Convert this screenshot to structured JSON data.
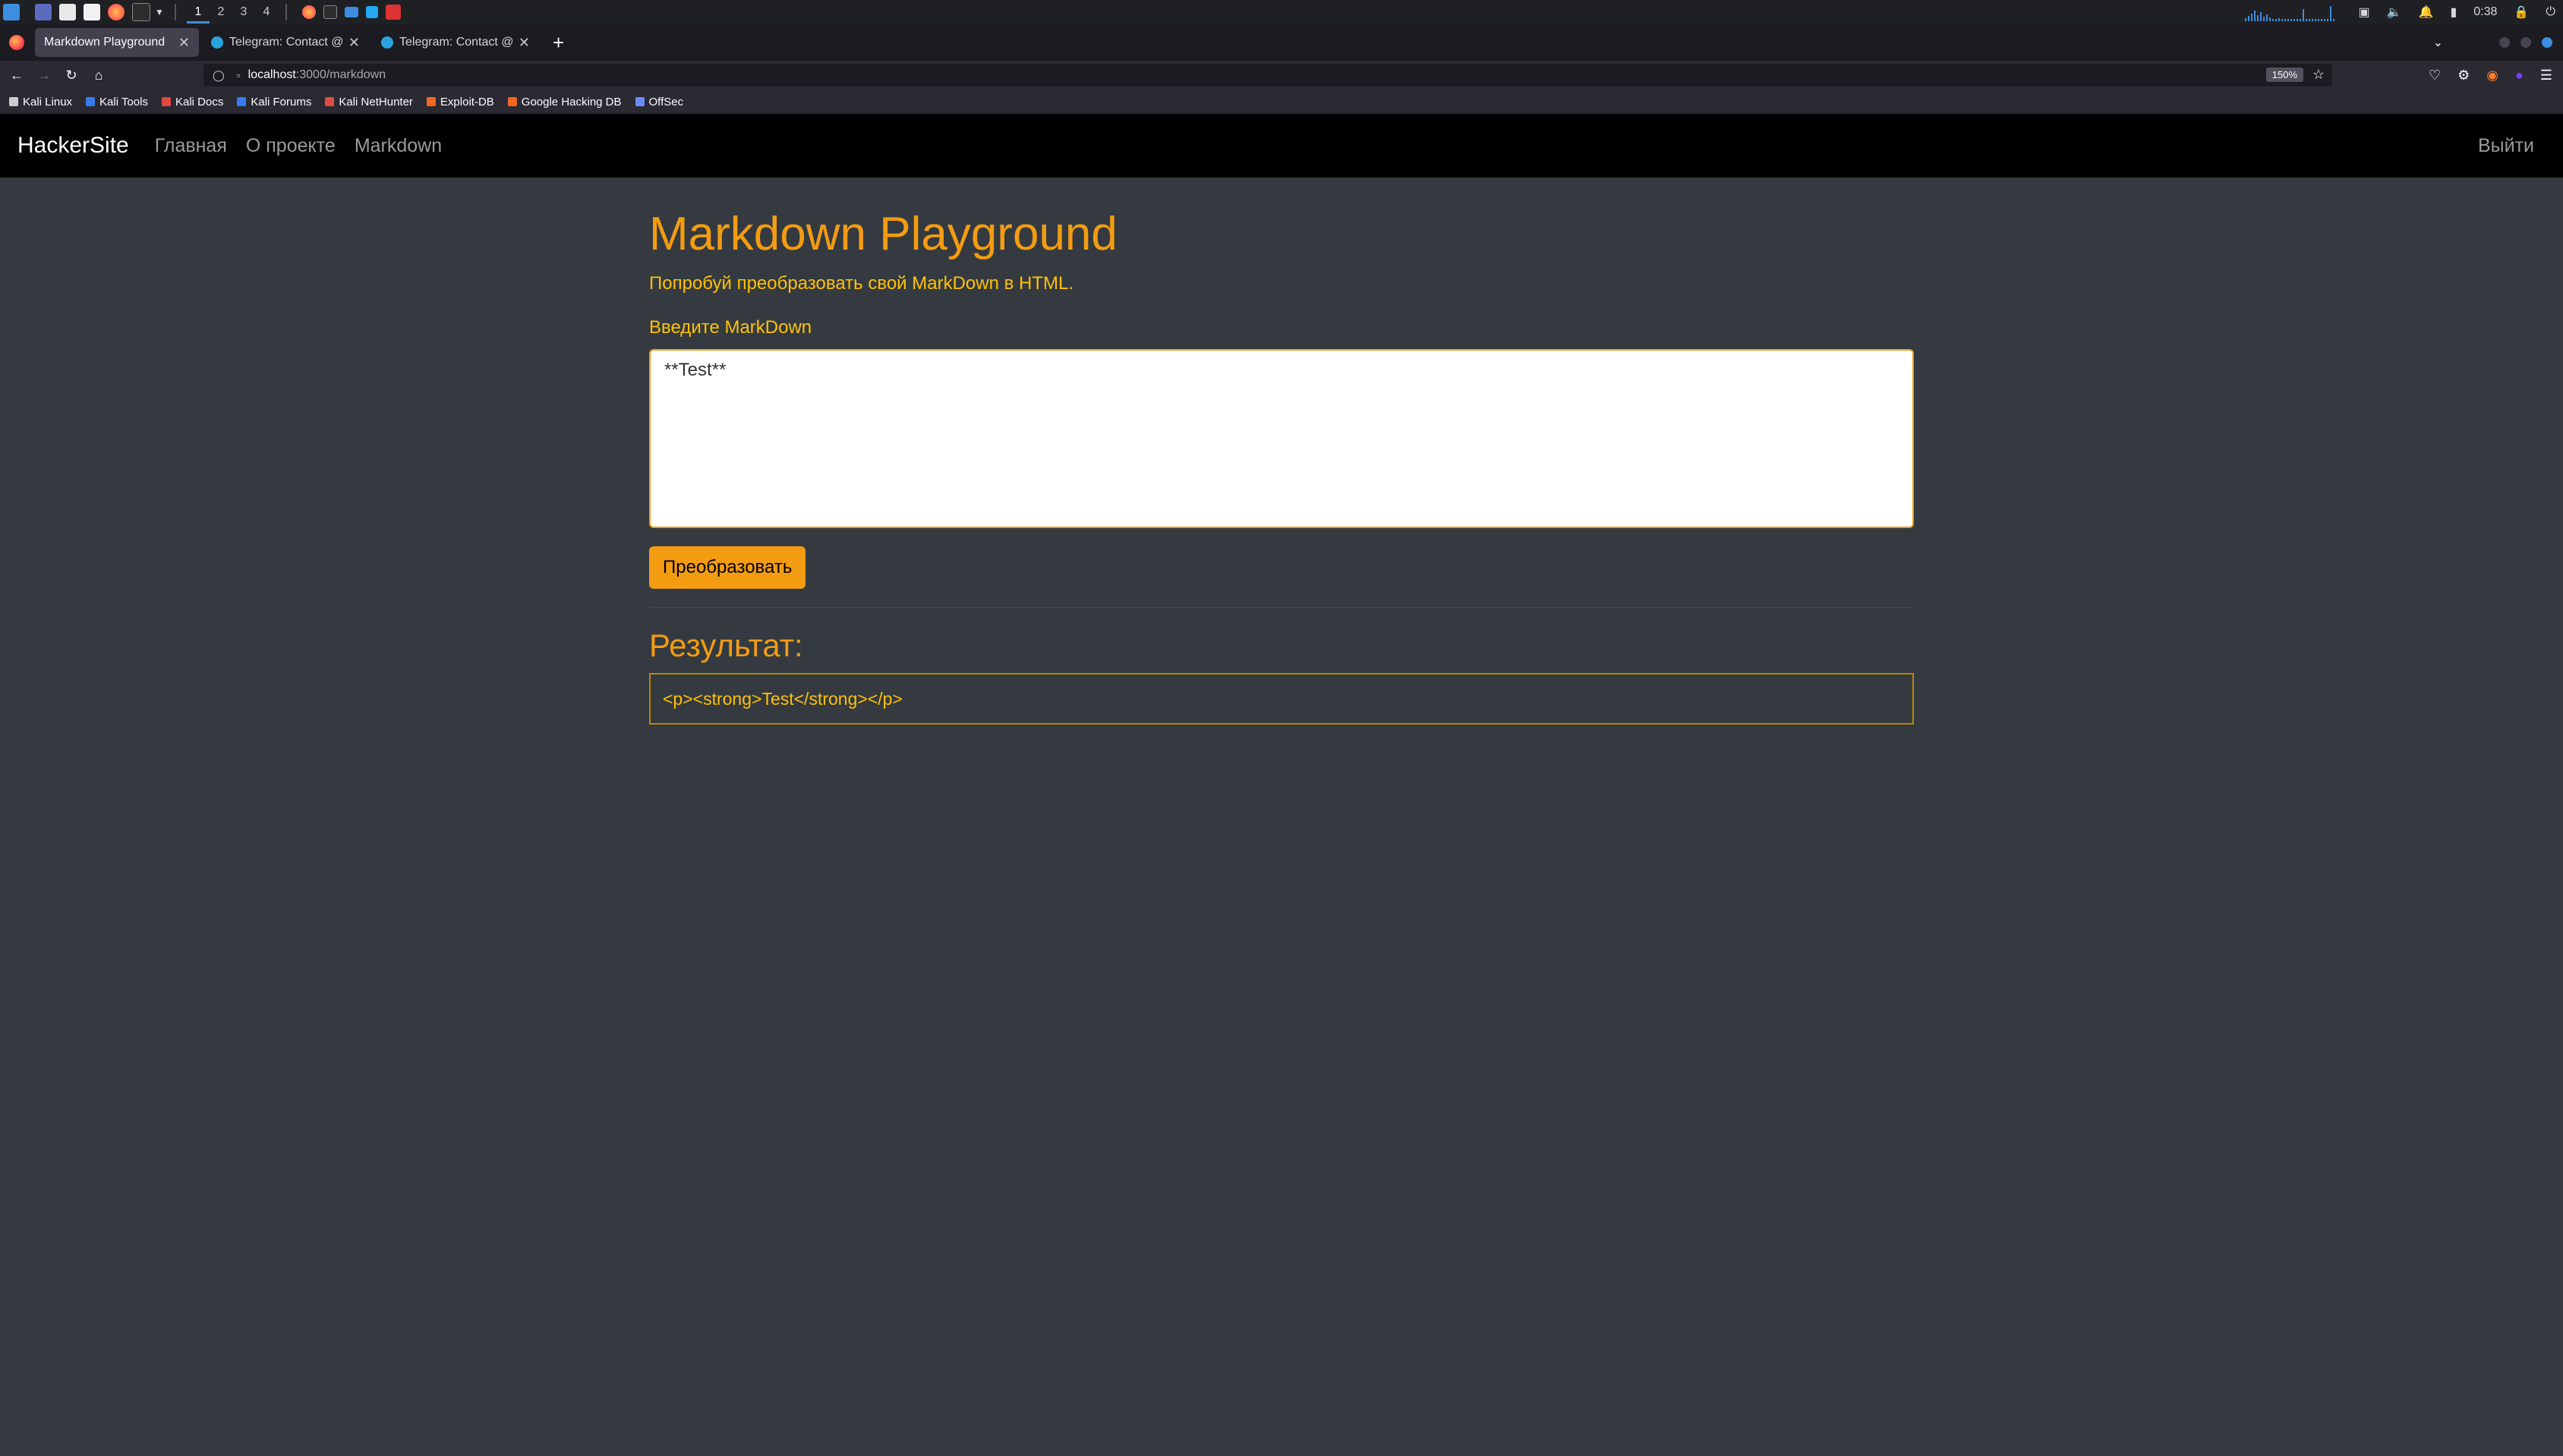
{
  "taskbar": {
    "workspaces": [
      "1",
      "2",
      "3",
      "4"
    ],
    "time": "0:38"
  },
  "browser": {
    "tabs": [
      {
        "label": "Markdown Playground",
        "active": true
      },
      {
        "label": "Telegram: Contact @fefu",
        "active": false
      },
      {
        "label": "Telegram: Contact @RDC",
        "active": false
      }
    ],
    "url_host": "localhost",
    "url_path": ":3000/markdown",
    "zoom": "150%",
    "bookmarks": [
      "Kali Linux",
      "Kali Tools",
      "Kali Docs",
      "Kali Forums",
      "Kali NetHunter",
      "Exploit-DB",
      "Google Hacking DB",
      "OffSec"
    ],
    "bookmark_colors": [
      "#cccccc",
      "#367bf0",
      "#e04a3f",
      "#367bf0",
      "#e04a3f",
      "#f26822",
      "#f26822",
      "#6b8cff"
    ]
  },
  "site": {
    "brand": "HackerSite",
    "nav": [
      "Главная",
      "О проекте",
      "Markdown"
    ],
    "logout": "Выйти"
  },
  "main": {
    "title": "Markdown Playground",
    "lead": "Попробуй преобразовать свой MarkDown в HTML.",
    "input_label": "Введите MarkDown",
    "input_value": "**Test**",
    "convert_button": "Преобразовать",
    "result_title": "Результат:",
    "result_value": "<p><strong>Test</strong></p>"
  },
  "colors": {
    "accent": "#f39c12",
    "text_warning": "#ffc107",
    "background": "#343a40",
    "navbar": "#000000"
  }
}
